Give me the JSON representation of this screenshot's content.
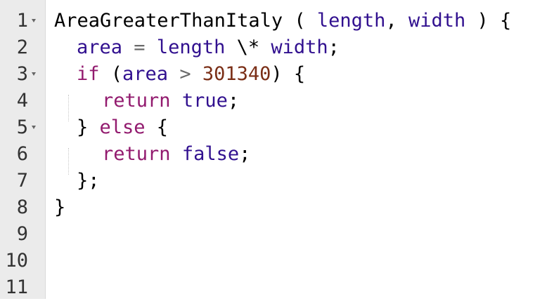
{
  "editor": {
    "line_numbers": [
      "1",
      "2",
      "3",
      "4",
      "5",
      "6",
      "7",
      "8",
      "9",
      "10",
      "11"
    ],
    "fold_marker_lines": [
      "1",
      "3",
      "5"
    ],
    "colors": {
      "gutter_background": "#ebebeb",
      "identifier": "#000000",
      "variable": "#31108f",
      "keyword": "#921a6e",
      "number": "#7a2e16",
      "operator": "#6a6a6a"
    },
    "fold_icon": "triangle-down-icon",
    "lines": [
      [
        "AreaGreaterThanItaly",
        " ( ",
        "length",
        ", ",
        "width",
        " ) {"
      ],
      [
        "area",
        " = ",
        "length",
        " \\* ",
        "width",
        ";"
      ],
      [
        "if",
        " (",
        "area",
        " > ",
        "301340",
        ") {"
      ],
      [
        "return",
        " ",
        "true",
        ";"
      ],
      [
        "} ",
        "else",
        " {"
      ],
      [
        "return",
        " ",
        "false",
        ";"
      ],
      [
        "};"
      ],
      [
        "}"
      ]
    ]
  }
}
